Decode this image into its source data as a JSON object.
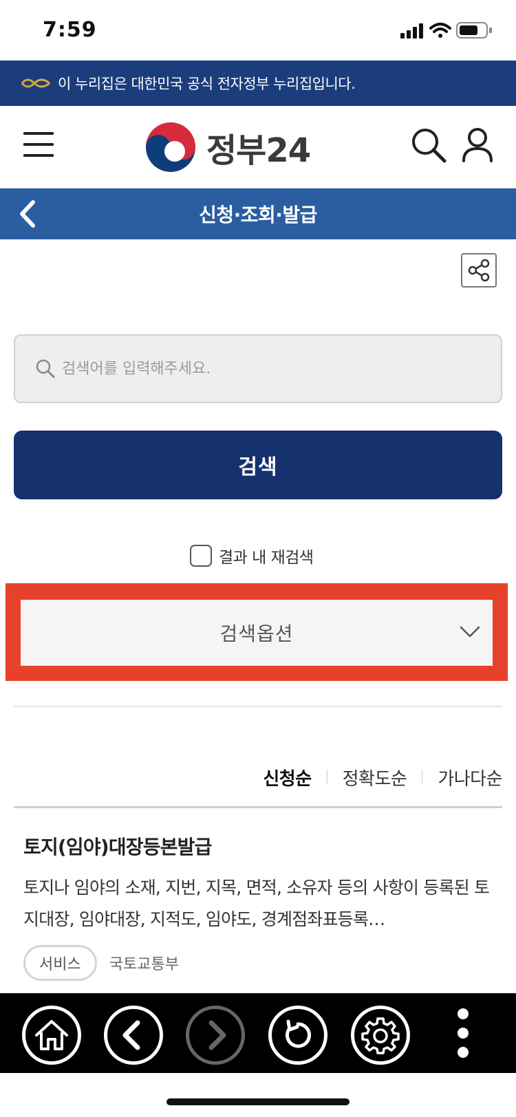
{
  "status_bar": {
    "time": "7:59",
    "icons": [
      "signal-icon",
      "wifi-icon",
      "battery-icon"
    ]
  },
  "gov_banner": {
    "text": "이 누리집은 대한민국 공식 전자정부 누리집입니다."
  },
  "header": {
    "logo_text": "정부24",
    "icons": [
      "menu-icon",
      "search-icon",
      "user-icon"
    ]
  },
  "title_bar": {
    "title": "신청·조회·발급"
  },
  "search": {
    "placeholder": "검색어를 입력해주세요.",
    "value": "",
    "submit_label": "검색"
  },
  "recheck": {
    "label": "결과 내 재검색",
    "checked": false
  },
  "options": {
    "label": "검색옵션"
  },
  "sort": {
    "items": [
      {
        "label": "신청순",
        "active": true
      },
      {
        "label": "정확도순",
        "active": false
      },
      {
        "label": "가나다순",
        "active": false
      }
    ]
  },
  "results": [
    {
      "title": "토지(임야)대장등본발급",
      "description": "토지나 임야의 소재, 지번, 지목, 면적, 소유자 등의 사항이 등록된 토지대장, 임야대장, 지적도, 임야도, 경계점좌표등록…",
      "badge": "서비스",
      "organization": "국토교통부"
    }
  ],
  "toolbar": {
    "buttons": [
      "home-icon",
      "back-icon",
      "forward-icon",
      "refresh-icon",
      "settings-icon",
      "more-icon"
    ]
  },
  "colors": {
    "banner": "#1b3d7c",
    "title_bar": "#2a5ea0",
    "primary_button": "#15316e",
    "highlight": "#e8412b"
  }
}
